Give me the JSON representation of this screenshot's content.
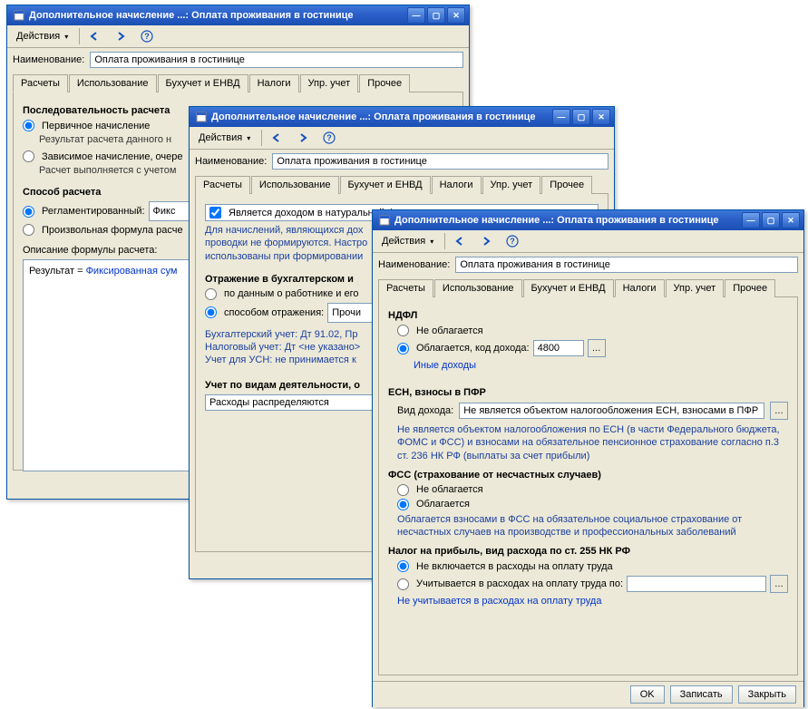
{
  "win1": {
    "title": "Дополнительное начисление ...: Оплата проживания в гостинице",
    "actions_label": "Действия",
    "name_label": "Наименование:",
    "name_value": "Оплата проживания в гостинице",
    "tabs": [
      "Расчеты",
      "Использование",
      "Бухучет и ЕНВД",
      "Налоги",
      "Упр. учет",
      "Прочее"
    ],
    "seq_header": "Последовательность расчета",
    "radio_primary": "Первичное начисление",
    "primary_sub": "Результат расчета данного н",
    "radio_dependent": "Зависимое начисление, очере",
    "dependent_sub": "Расчет выполняется с учетом",
    "method_header": "Способ расчета",
    "radio_regulated": "Регламентированный:",
    "regulated_value": "Фикс",
    "radio_custom": "Произвольная формула расче",
    "formula_label": "Описание формулы расчета:",
    "formula_prefix": "Результат = ",
    "formula_link": "Фиксированная сум"
  },
  "win2": {
    "title": "Дополнительное начисление ...: Оплата проживания в гостинице",
    "actions_label": "Действия",
    "name_label": "Наименование:",
    "name_value": "Оплата проживания в гостинице",
    "tabs": [
      "Расчеты",
      "Использование",
      "Бухучет и ЕНВД",
      "Налоги",
      "Упр. учет",
      "Прочее"
    ],
    "check_income": "Является доходом в натуральной форме",
    "income_note1": "Для начислений, являющихся дох",
    "income_note2": "проводки не формируются. Настро",
    "income_note3": "использованы при формировании",
    "reflect_header": "Отражение в бухгалтерском и",
    "radio_by_employee": "по данным о работнике и его",
    "radio_by_method": "способом отражения:",
    "method_value": "Прочи",
    "bu_line": "Бухгалтерский учет: Дт 91.02, Пр",
    "nu_line": "Налоговый учет: Дт <не указано>",
    "usn_line": "Учет для УСН: не принимается к",
    "activity_header": "Учет по видам деятельности, о",
    "activity_value": "Расходы распределяются"
  },
  "win3": {
    "title": "Дополнительное начисление ...: Оплата проживания в гостинице",
    "actions_label": "Действия",
    "name_label": "Наименование:",
    "name_value": "Оплата проживания в гостинице",
    "tabs": [
      "Расчеты",
      "Использование",
      "Бухучет и ЕНВД",
      "Налоги",
      "Упр. учет",
      "Прочее"
    ],
    "ndfl_header": "НДФЛ",
    "ndfl_no": "Не облагается",
    "ndfl_yes": "Облагается, код дохода:",
    "ndfl_code": "4800",
    "ndfl_link": "Иные доходы",
    "esn_header": "ЕСН, взносы в ПФР",
    "esn_kind_label": "Вид дохода:",
    "esn_kind_value": "Не является объектом налогообложения ЕСН, взносами в ПФР с",
    "esn_note": "Не является объектом налогообложения по ЕСН (в части Федерального бюджета, ФОМС и ФСС) и взносами на обязательное пенсионное страхование согласно п.3 ст. 236 НК РФ (выплаты за счет прибыли)",
    "fss_header": "ФСС (страхование от несчастных случаев)",
    "fss_no": "Не облагается",
    "fss_yes": "Облагается",
    "fss_note": "Облагается взносами в ФСС на обязательное социальное страхование от несчастных случаев на производстве и профессиональных заболеваний",
    "profit_header": "Налог на прибыль, вид расхода по ст. 255 НК РФ",
    "profit_no": "Не включается в расходы на оплату труда",
    "profit_yes": "Учитывается в расходах на оплату труда по:",
    "profit_link": "Не учитывается в расходах на оплату труда",
    "btn_ok": "OK",
    "btn_save": "Записать",
    "btn_close": "Закрыть"
  },
  "footer": {
    "btn_ok": "OK",
    "btn_save": "Записать",
    "btn_close": "Закрыть"
  }
}
